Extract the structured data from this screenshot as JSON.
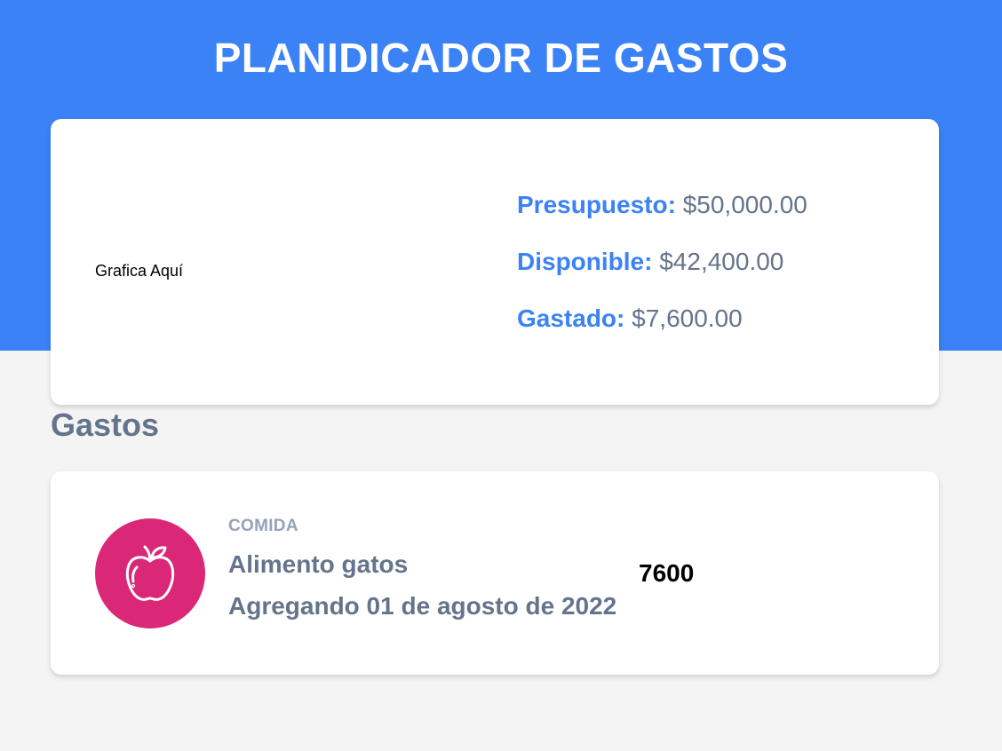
{
  "header": {
    "title": "PLANIDICADOR DE GASTOS",
    "accent_color": "#3b82f6"
  },
  "budget": {
    "chart_placeholder": "Grafica Aquí",
    "budget_label": "Presupuesto:",
    "budget_value": "$50,000.00",
    "available_label": "Disponible:",
    "available_value": "$42,400.00",
    "spent_label": "Gastado:",
    "spent_value": "$7,600.00"
  },
  "expenses": {
    "section_title": "Gastos",
    "items": [
      {
        "icon": "apple-icon",
        "icon_color": "#db2777",
        "category": "COMIDA",
        "name": "Alimento gatos",
        "date": "Agregando 01 de agosto de 2022",
        "amount": "7600"
      }
    ]
  }
}
